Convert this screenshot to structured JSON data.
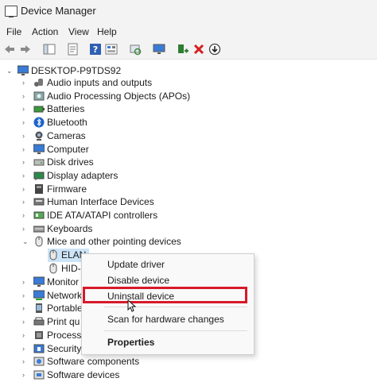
{
  "window": {
    "title": "Device Manager"
  },
  "menu": [
    "File",
    "Action",
    "View",
    "Help"
  ],
  "toolbar_icons": [
    "back-arrow-icon",
    "forward-arrow-icon",
    "show-hide-console-tree-icon",
    "properties-icon",
    "help-icon",
    "action-pane-icon",
    "scan-hardware-icon",
    "monitor-icon",
    "enable-device-icon",
    "uninstall-x-icon",
    "update-driver-icon"
  ],
  "tree": {
    "root": "DESKTOP-P9TDS92",
    "items": [
      "Audio inputs and outputs",
      "Audio Processing Objects (APOs)",
      "Batteries",
      "Bluetooth",
      "Cameras",
      "Computer",
      "Disk drives",
      "Display adapters",
      "Firmware",
      "Human Interface Devices",
      "IDE ATA/ATAPI controllers",
      "Keyboards",
      "Mice and other pointing devices"
    ],
    "mice_children": [
      "ELAN",
      "HID-"
    ],
    "after_items": [
      "Monitor",
      "Network",
      "Portable",
      "Print qu",
      "Process",
      "Security",
      "Software components",
      "Software devices"
    ]
  },
  "context_menu": {
    "update": "Update driver",
    "disable": "Disable device",
    "uninstall": "Uninstall device",
    "scan": "Scan for hardware changes",
    "properties": "Properties"
  },
  "colors": {
    "highlight": "#d7192a",
    "selection": "#cce4f7"
  }
}
